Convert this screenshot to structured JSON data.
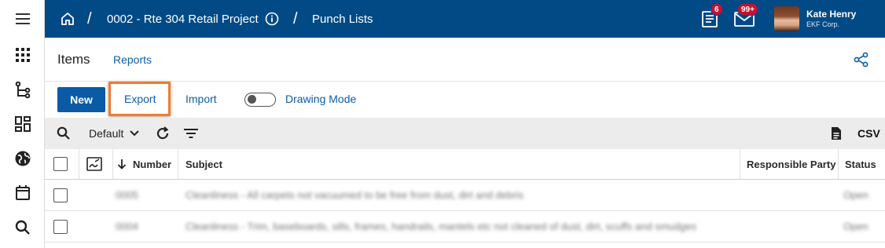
{
  "rail": {
    "items": [
      {
        "name": "menu-icon"
      },
      {
        "name": "apps-grid-icon"
      },
      {
        "name": "hierarchy-icon"
      },
      {
        "name": "dashboard-icon"
      },
      {
        "name": "globe-icon"
      },
      {
        "name": "calendar-icon"
      },
      {
        "name": "search-icon"
      }
    ]
  },
  "topbar": {
    "home_icon": "home-icon",
    "project": "0002 - Rte 304 Retail Project",
    "info_icon": "info-icon",
    "section": "Punch Lists",
    "notifications_count": "6",
    "messages_count": "99+",
    "user_name": "Kate Henry",
    "user_org": "EKF Corp."
  },
  "page": {
    "title": "Items",
    "tab_reports": "Reports",
    "share_icon": "share-icon"
  },
  "actions": {
    "new_label": "New",
    "export_label": "Export",
    "import_label": "Import",
    "drawing_mode_label": "Drawing Mode",
    "drawing_mode_on": false
  },
  "toolbar": {
    "view_label": "Default",
    "csv_label": "CSV"
  },
  "table": {
    "columns": {
      "number": "Number",
      "subject": "Subject",
      "responsible": "Responsible Party",
      "status": "Status"
    },
    "rows": [
      {
        "number": "0005",
        "subject": "Cleanliness - All carpets not vacuumed to be free from dust, dirt and debris",
        "status": "Open"
      },
      {
        "number": "0004",
        "subject": "Cleanliness - Trim, baseboards, sills, frames, handrails, mantels etc not cleaned of dust, dirt, scuffs and smudges",
        "status": "Open"
      }
    ]
  },
  "colors": {
    "header_bg": "#014a86",
    "accent": "#0a5aa5",
    "highlight": "#f07c2f",
    "badge": "#c8102e"
  }
}
